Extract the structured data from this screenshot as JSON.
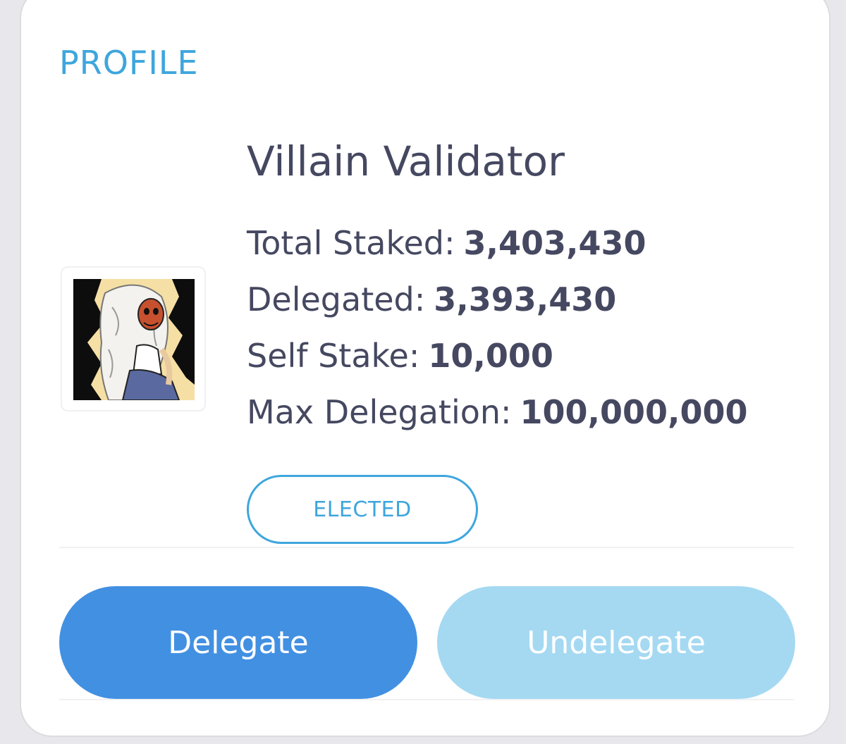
{
  "profile": {
    "section_title": "PROFILE",
    "validator_name": "Villain Validator",
    "avatar_icon": "anime-character-avatar",
    "stats": [
      {
        "label": "Total Staked:",
        "value": "3,403,430"
      },
      {
        "label": "Delegated:",
        "value": "3,393,430"
      },
      {
        "label": "Self Stake:",
        "value": "10,000"
      },
      {
        "label": "Max Delegation:",
        "value": "100,000,000"
      }
    ],
    "status_badge": "ELECTED"
  },
  "actions": {
    "delegate_label": "Delegate",
    "undelegate_label": "Undelegate"
  },
  "colors": {
    "accent": "#3ea6dd",
    "primary_button": "#4290e2",
    "secondary_button": "#a5d9f2",
    "text": "#454860"
  }
}
